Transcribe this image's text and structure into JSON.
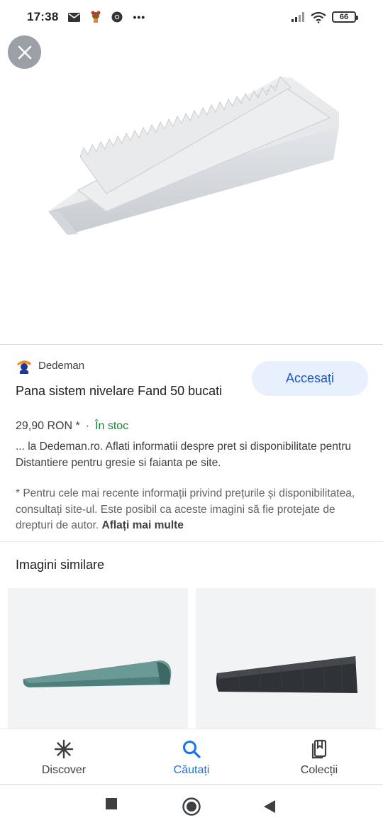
{
  "status_bar": {
    "time": "17:38",
    "battery": "66",
    "icons": [
      "mail-icon",
      "app-notification-icon",
      "chrome-icon",
      "more-icon",
      "signal-icon",
      "wifi-icon",
      "battery-icon"
    ],
    "more": "•••"
  },
  "viewer": {
    "close_icon": "close-icon"
  },
  "result": {
    "source": "Dedeman",
    "title": "Pana sistem nivelare Fand 50 bucati",
    "button_label": "Accesați",
    "price": "29,90 RON *",
    "separator": "·",
    "stock": "În stoc",
    "description": "... la Dedeman.ro. Aflati informatii despre pret si disponibilitate pentru Distantiere pentru gresie si faianta pe site.",
    "disclaimer": "* Pentru cele mai recente informații privind prețurile și disponibilitatea, consultați site-ul. Este posibil ca aceste imagini să fie protejate de drepturi de autor.",
    "learn_more": "Aflați mai multe"
  },
  "similar": {
    "title": "Imagini similare"
  },
  "bottom_nav": {
    "items": [
      {
        "label": "Discover",
        "icon": "discover-icon"
      },
      {
        "label": "Căutați",
        "icon": "search-icon"
      },
      {
        "label": "Colecții",
        "icon": "collections-icon"
      }
    ]
  },
  "system_nav": {
    "icons": [
      "recents-icon",
      "home-icon",
      "back-icon"
    ]
  },
  "colors": {
    "accent": "#1a73e8",
    "button_bg": "#e8f0fe",
    "stock_green": "#188038"
  }
}
